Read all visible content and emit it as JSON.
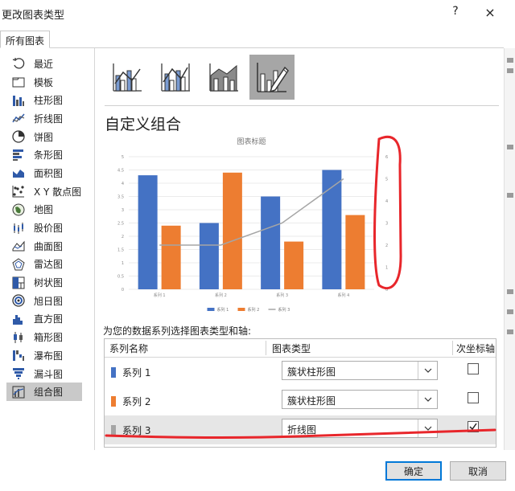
{
  "window": {
    "title": "更改图表类型",
    "help": "?",
    "close": "×"
  },
  "tabs": [
    {
      "label": "所有图表"
    }
  ],
  "sidebar": {
    "items": [
      {
        "label": "最近",
        "icon": "recent-icon"
      },
      {
        "label": "模板",
        "icon": "template-icon"
      },
      {
        "label": "柱形图",
        "icon": "column-chart-icon"
      },
      {
        "label": "折线图",
        "icon": "line-chart-icon"
      },
      {
        "label": "饼图",
        "icon": "pie-chart-icon"
      },
      {
        "label": "条形图",
        "icon": "bar-chart-icon"
      },
      {
        "label": "面积图",
        "icon": "area-chart-icon"
      },
      {
        "label": "X Y 散点图",
        "icon": "scatter-chart-icon"
      },
      {
        "label": "地图",
        "icon": "map-chart-icon"
      },
      {
        "label": "股价图",
        "icon": "stock-chart-icon"
      },
      {
        "label": "曲面图",
        "icon": "surface-chart-icon"
      },
      {
        "label": "雷达图",
        "icon": "radar-chart-icon"
      },
      {
        "label": "树状图",
        "icon": "treemap-chart-icon"
      },
      {
        "label": "旭日图",
        "icon": "sunburst-chart-icon"
      },
      {
        "label": "直方图",
        "icon": "histogram-chart-icon"
      },
      {
        "label": "箱形图",
        "icon": "box-whisker-chart-icon"
      },
      {
        "label": "瀑布图",
        "icon": "waterfall-chart-icon"
      },
      {
        "label": "漏斗图",
        "icon": "funnel-chart-icon"
      },
      {
        "label": "组合图",
        "icon": "combo-chart-icon"
      }
    ],
    "selected_index": 18
  },
  "main": {
    "subtypes": [
      {
        "icon": "clustered-column-line-icon"
      },
      {
        "icon": "clustered-column-line-secondary-icon"
      },
      {
        "icon": "stacked-area-clustered-column-icon"
      },
      {
        "icon": "custom-combination-icon"
      }
    ],
    "selected_subtype": 3,
    "section_title": "自定义组合",
    "chooser_label": "为您的数据系列选择图表类型和轴:"
  },
  "table": {
    "headers": {
      "name": "系列名称",
      "type": "图表类型",
      "secondary": "次坐标轴"
    },
    "rows": [
      {
        "name": "系列 1",
        "type": "簇状柱形图",
        "secondary_axis": false,
        "color": "#4472c4",
        "selected": false
      },
      {
        "name": "系列 2",
        "type": "簇状柱形图",
        "secondary_axis": false,
        "color": "#ed7d31",
        "selected": false
      },
      {
        "name": "系列 3",
        "type": "折线图",
        "secondary_axis": true,
        "color": "#a5a5a5",
        "selected": true
      }
    ]
  },
  "buttons": {
    "ok": "确定",
    "cancel": "取消"
  },
  "colors": {
    "annotation": "#e8262b",
    "accent": "#0078d7"
  },
  "chart_data": {
    "type": "bar",
    "title": "图表标题",
    "categories": [
      "系列 1",
      "系列 2",
      "系列 3",
      "系列 4"
    ],
    "series": [
      {
        "name": "系列 1",
        "type": "bar",
        "color": "#4472c4",
        "values": [
          4.3,
          2.5,
          3.5,
          4.5
        ]
      },
      {
        "name": "系列 2",
        "type": "bar",
        "color": "#ed7d31",
        "values": [
          2.4,
          4.4,
          1.8,
          2.8
        ]
      },
      {
        "name": "系列 3",
        "type": "line",
        "axis": "secondary",
        "color": "#a5a5a5",
        "values": [
          2,
          2,
          3,
          5
        ]
      }
    ],
    "y_ticks": [
      "0",
      "0.5",
      "1",
      "1.5",
      "2",
      "2.5",
      "3",
      "3.5",
      "4",
      "4.5",
      "5"
    ],
    "y2_ticks": [
      "0",
      "1",
      "2",
      "3",
      "4",
      "5",
      "6"
    ],
    "ylim": [
      0,
      5
    ],
    "y2lim": [
      0,
      6
    ],
    "legend_position": "bottom",
    "grid": true
  }
}
